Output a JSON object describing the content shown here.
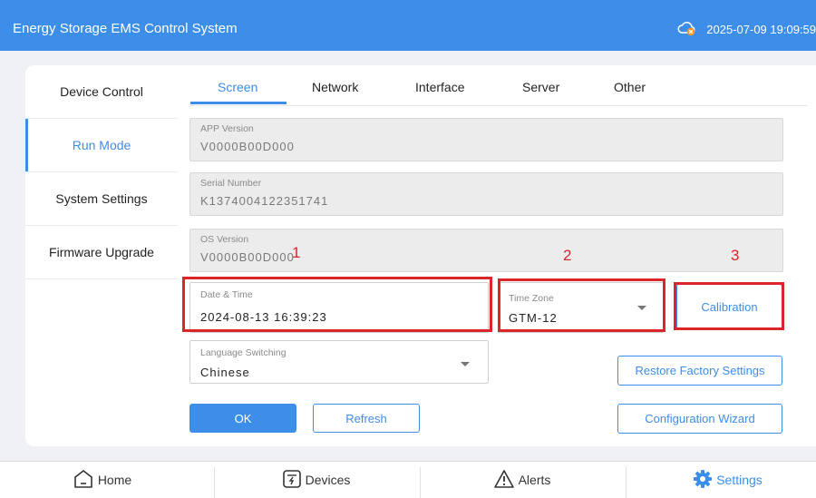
{
  "header": {
    "title": "Energy Storage EMS Control System",
    "datetime": "2025-07-09 19:09:59",
    "cloud_icon": "cloud-error-icon"
  },
  "sidebar": {
    "items": [
      {
        "label": "Device Control",
        "active": false
      },
      {
        "label": "Run Mode",
        "active": true
      },
      {
        "label": "System Settings",
        "active": false
      },
      {
        "label": "Firmware Upgrade",
        "active": false
      }
    ]
  },
  "tabs": [
    {
      "label": "Screen",
      "active": true
    },
    {
      "label": "Network",
      "active": false
    },
    {
      "label": "Interface",
      "active": false
    },
    {
      "label": "Server",
      "active": false
    },
    {
      "label": "Other",
      "active": false
    }
  ],
  "info": {
    "app_version": {
      "label": "APP Version",
      "value": "V0000B00D000"
    },
    "serial_number": {
      "label": "Serial Number",
      "value": "K1374004122351741"
    },
    "os_version": {
      "label": "OS Version",
      "value": "V0000B00D000"
    }
  },
  "datetime_field": {
    "label": "Date & Time",
    "value": "2024-08-13 16:39:23"
  },
  "timezone_field": {
    "label": "Time Zone",
    "value": "GTM-12"
  },
  "language_field": {
    "label": "Language Switching",
    "value": "Chinese"
  },
  "buttons": {
    "calibration": "Calibration",
    "restore": "Restore Factory Settings",
    "wizard": "Configuration Wizard",
    "ok": "OK",
    "refresh": "Refresh"
  },
  "annotations": [
    "1",
    "2",
    "3"
  ],
  "bottom_nav": [
    {
      "label": "Home",
      "icon": "home-icon"
    },
    {
      "label": "Devices",
      "icon": "devices-icon"
    },
    {
      "label": "Alerts",
      "icon": "alert-icon"
    },
    {
      "label": "Settings",
      "icon": "gear-icon"
    }
  ],
  "colors": {
    "accent": "#3d8ee9",
    "highlight": "#d9262b"
  }
}
